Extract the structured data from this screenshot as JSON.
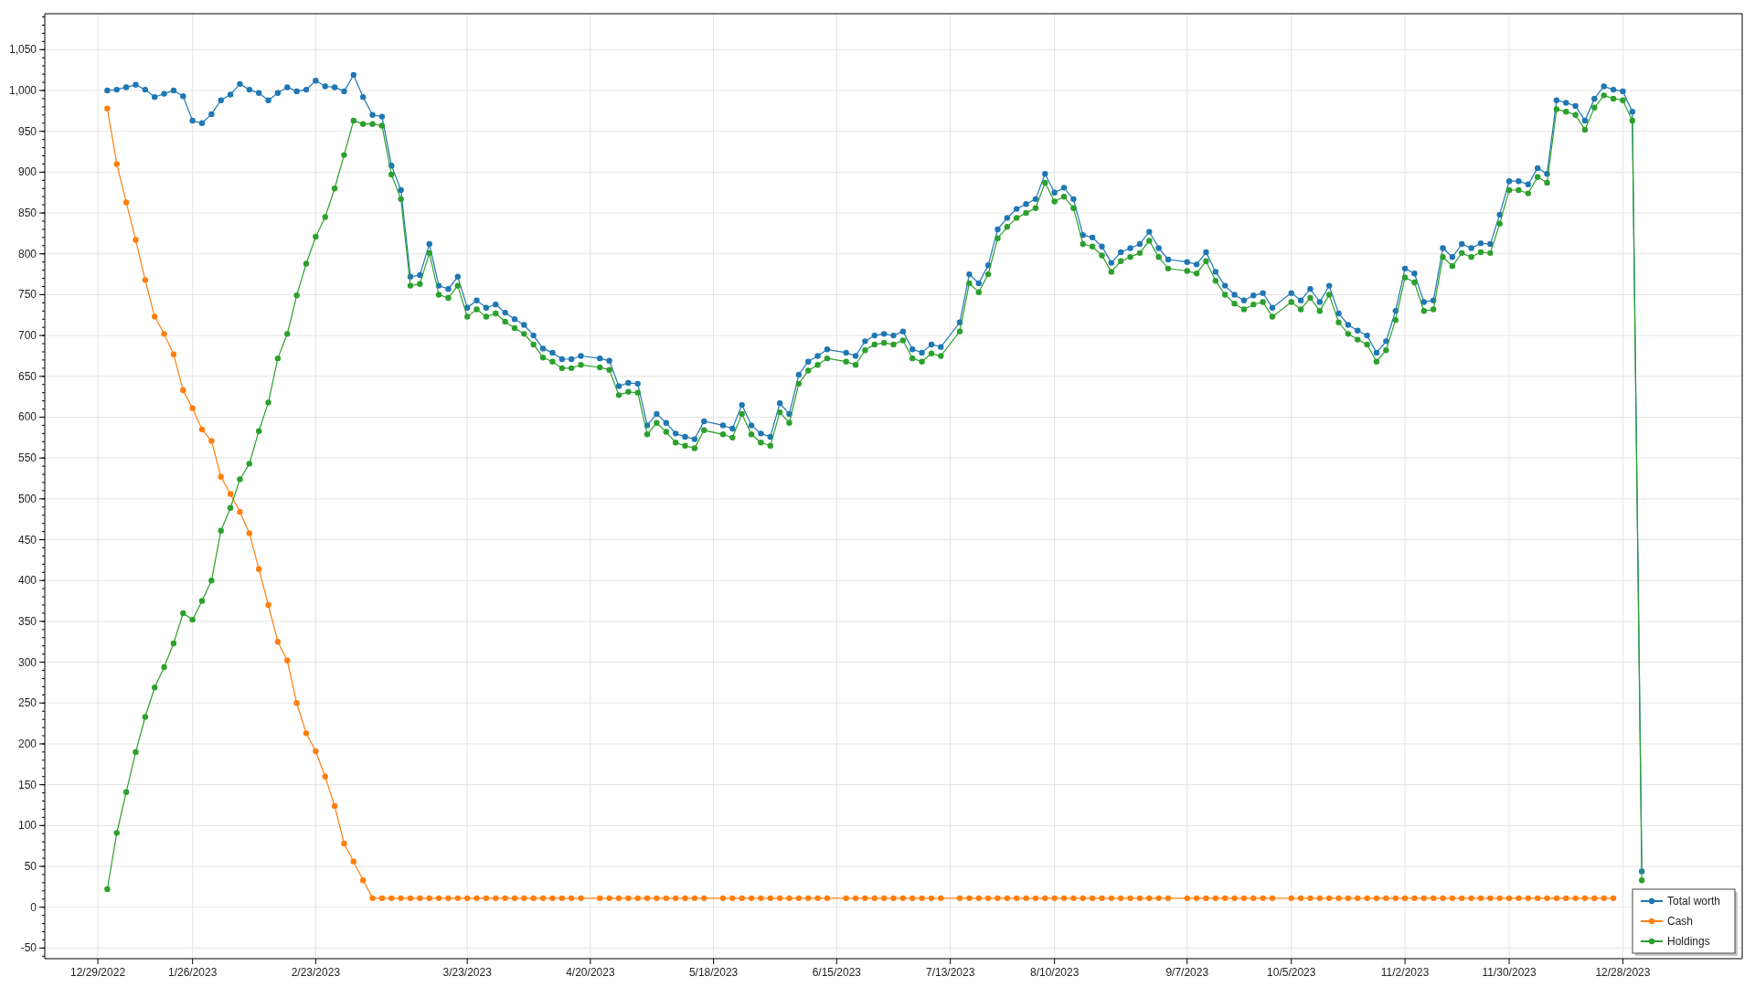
{
  "chart": {
    "chart_data": {
      "type": "line",
      "categories": [
        "12/29/2022",
        null,
        null,
        null,
        null,
        null,
        null,
        null,
        null,
        null,
        "1/26/2023",
        null,
        null,
        null,
        null,
        null,
        null,
        null,
        null,
        null,
        null,
        null,
        null,
        "2/23/2023",
        null,
        null,
        null,
        null,
        null,
        null,
        null,
        null,
        null,
        null,
        null,
        null,
        null,
        null,
        null,
        "3/23/2023",
        null,
        null,
        null,
        null,
        null,
        null,
        null,
        null,
        null,
        null,
        null,
        null,
        "4/20/2023",
        null,
        null,
        null,
        null,
        null,
        null,
        null,
        null,
        null,
        null,
        null,
        null,
        "5/18/2023",
        null,
        null,
        null,
        null,
        null,
        null,
        null,
        null,
        null,
        null,
        null,
        null,
        "6/15/2023",
        null,
        null,
        null,
        null,
        null,
        null,
        null,
        null,
        null,
        null,
        null,
        "7/13/2023",
        null,
        null,
        null,
        null,
        null,
        null,
        null,
        null,
        null,
        null,
        "8/10/2023",
        null,
        null,
        null,
        null,
        null,
        null,
        null,
        null,
        null,
        null,
        null,
        null,
        null,
        "9/7/2023",
        null,
        null,
        null,
        null,
        null,
        null,
        null,
        null,
        null,
        null,
        "10/5/2023",
        null,
        null,
        null,
        null,
        null,
        null,
        null,
        null,
        null,
        null,
        null,
        "11/2/2023",
        null,
        null,
        null,
        null,
        null,
        null,
        null,
        null,
        null,
        null,
        "11/30/2023",
        null,
        null,
        null,
        null,
        null,
        null,
        null,
        null,
        null,
        null,
        null,
        "12/28/2023",
        null,
        null
      ],
      "series": [
        {
          "name": "Total worth",
          "color": "#1f77b4",
          "marker": "circle",
          "values": [
            null,
            1000,
            1001,
            1004,
            1007,
            1001,
            992,
            996,
            1000,
            993,
            963,
            960,
            971,
            988,
            995,
            1008,
            1001,
            997,
            988,
            997,
            1004,
            999,
            1001,
            1012,
            1005,
            1004,
            999,
            1019,
            992,
            970,
            968,
            908,
            878,
            772,
            774,
            812,
            761,
            757,
            772,
            734,
            743,
            734,
            738,
            728,
            720,
            713,
            700,
            684,
            679,
            671,
            671,
            675,
            null,
            672,
            669,
            638,
            642,
            641,
            590,
            604,
            593,
            580,
            576,
            573,
            595,
            null,
            590,
            586,
            615,
            590,
            580,
            576,
            617,
            604,
            652,
            668,
            675,
            683,
            null,
            679,
            675,
            693,
            700,
            702,
            700,
            705,
            683,
            679,
            689,
            686,
            null,
            716,
            775,
            764,
            786,
            830,
            844,
            855,
            861,
            867,
            898,
            875,
            881,
            867,
            823,
            820,
            809,
            789,
            802,
            807,
            812,
            827,
            807,
            793,
            null,
            790,
            787,
            802,
            778,
            761,
            750,
            743,
            749,
            752,
            734,
            null,
            752,
            743,
            757,
            741,
            761,
            727,
            713,
            706,
            700,
            679,
            693,
            730,
            782,
            776,
            741,
            743,
            807,
            796,
            812,
            807,
            813,
            812,
            848,
            889,
            889,
            885,
            905,
            898,
            988,
            985,
            981,
            963,
            990,
            1005,
            1001,
            999,
            974,
            44
          ]
        },
        {
          "name": "Cash",
          "color": "#ff7f0e",
          "marker": "circle",
          "values": [
            null,
            978,
            910,
            863,
            817,
            768,
            723,
            702,
            677,
            633,
            611,
            585,
            571,
            527,
            506,
            484,
            458,
            414,
            370,
            325,
            302,
            250,
            213,
            191,
            160,
            124,
            78,
            56,
            33,
            11,
            11,
            11,
            11,
            11,
            11,
            11,
            11,
            11,
            11,
            11,
            11,
            11,
            11,
            11,
            11,
            11,
            11,
            11,
            11,
            11,
            11,
            11,
            null,
            11,
            11,
            11,
            11,
            11,
            11,
            11,
            11,
            11,
            11,
            11,
            11,
            null,
            11,
            11,
            11,
            11,
            11,
            11,
            11,
            11,
            11,
            11,
            11,
            11,
            null,
            11,
            11,
            11,
            11,
            11,
            11,
            11,
            11,
            11,
            11,
            11,
            null,
            11,
            11,
            11,
            11,
            11,
            11,
            11,
            11,
            11,
            11,
            11,
            11,
            11,
            11,
            11,
            11,
            11,
            11,
            11,
            11,
            11,
            11,
            11,
            null,
            11,
            11,
            11,
            11,
            11,
            11,
            11,
            11,
            11,
            11,
            null,
            11,
            11,
            11,
            11,
            11,
            11,
            11,
            11,
            11,
            11,
            11,
            11,
            11,
            11,
            11,
            11,
            11,
            11,
            11,
            11,
            11,
            11,
            11,
            11,
            11,
            11,
            11,
            11,
            11,
            11,
            11,
            11,
            11,
            11,
            11,
            null,
            null,
            null
          ]
        },
        {
          "name": "Holdings",
          "color": "#2ca02c",
          "marker": "circle",
          "values": [
            null,
            22,
            91,
            141,
            190,
            233,
            269,
            294,
            323,
            360,
            352,
            375,
            400,
            461,
            489,
            524,
            543,
            583,
            618,
            672,
            702,
            749,
            788,
            821,
            845,
            880,
            921,
            963,
            959,
            959,
            957,
            897,
            867,
            761,
            763,
            801,
            750,
            746,
            761,
            723,
            732,
            723,
            727,
            717,
            709,
            702,
            689,
            673,
            668,
            660,
            660,
            664,
            null,
            661,
            658,
            627,
            631,
            630,
            579,
            593,
            582,
            569,
            565,
            562,
            584,
            null,
            579,
            575,
            604,
            579,
            569,
            565,
            606,
            593,
            641,
            657,
            664,
            672,
            null,
            668,
            664,
            682,
            689,
            691,
            689,
            694,
            672,
            668,
            678,
            675,
            null,
            705,
            764,
            753,
            775,
            819,
            833,
            844,
            850,
            856,
            887,
            864,
            870,
            856,
            812,
            809,
            798,
            778,
            791,
            796,
            801,
            816,
            796,
            782,
            null,
            779,
            776,
            791,
            767,
            750,
            739,
            732,
            738,
            741,
            723,
            null,
            741,
            732,
            746,
            730,
            750,
            716,
            702,
            695,
            689,
            668,
            682,
            719,
            771,
            765,
            730,
            732,
            796,
            785,
            801,
            796,
            802,
            801,
            837,
            878,
            878,
            874,
            894,
            887,
            977,
            974,
            970,
            952,
            979,
            994,
            990,
            988,
            963,
            33
          ]
        }
      ],
      "grid": true,
      "legend": true,
      "ylim": [
        -63,
        1094
      ],
      "yticks": [
        -50,
        0,
        50,
        100,
        150,
        200,
        250,
        300,
        350,
        400,
        450,
        500,
        550,
        600,
        650,
        700,
        750,
        800,
        850,
        900,
        950,
        {
          "value": 1000,
          "label": "1,000"
        },
        {
          "value": 1050,
          "label": "1,050"
        }
      ]
    }
  }
}
